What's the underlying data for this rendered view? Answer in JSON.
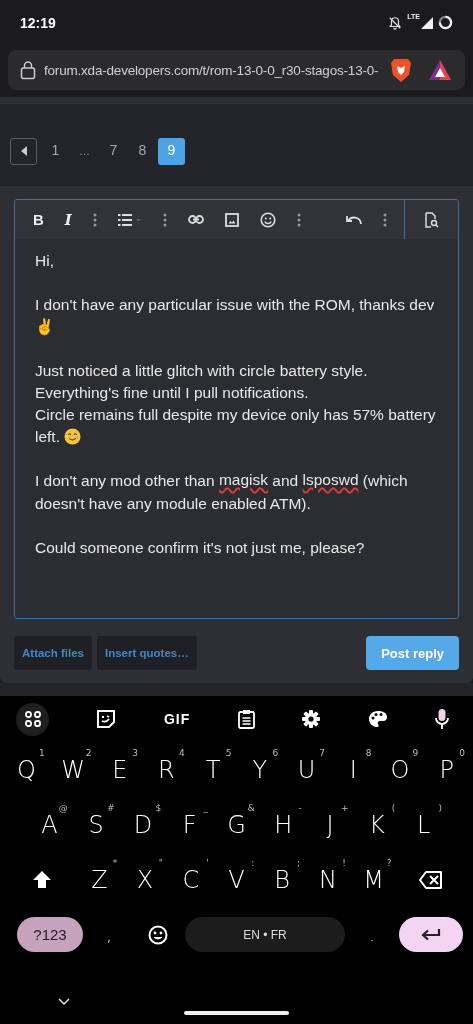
{
  "status_bar": {
    "time": "12:19",
    "network": "LTE"
  },
  "browser": {
    "url": "forum.xda-developers.com/t/rom-13-0-0_r30-stagos-13-0-"
  },
  "pagination": [
    {
      "kind": "page",
      "label": "1",
      "selected": false
    },
    {
      "kind": "gap",
      "label": "…"
    },
    {
      "kind": "page",
      "label": "7",
      "selected": false
    },
    {
      "kind": "page",
      "label": "8",
      "selected": false
    },
    {
      "kind": "page",
      "label": "9",
      "selected": true
    }
  ],
  "editor": {
    "toolbar": {
      "bold": "B",
      "italic": "I"
    },
    "paragraphs": [
      [
        [
          {
            "kind": "text",
            "text": "Hi,"
          }
        ]
      ],
      [
        [
          {
            "kind": "text",
            "text": "I don't have any particular issue with the ROM, thanks dev ✌"
          }
        ]
      ],
      [
        [
          {
            "kind": "text",
            "text": "Just noticed a little glitch with circle battery style."
          }
        ],
        [
          {
            "kind": "text",
            "text": "Everything's fine until I pull notifications."
          }
        ],
        [
          {
            "kind": "text",
            "text": "Circle remains full despite my device only has 57% battery left. "
          },
          {
            "kind": "emoji"
          }
        ]
      ],
      [
        [
          {
            "kind": "text",
            "text": "I don't any mod other than "
          },
          {
            "kind": "text",
            "text": "magisk",
            "misspelled": true
          },
          {
            "kind": "text",
            "text": " and "
          },
          {
            "kind": "text",
            "text": "lsposwd",
            "misspelled": true
          },
          {
            "kind": "text",
            "text": " (which doesn't have any module enabled ATM)."
          }
        ]
      ],
      [
        [
          {
            "kind": "text",
            "text": "Could someone confirm it's not just me, please?"
          }
        ]
      ]
    ]
  },
  "actions": {
    "attach": "Attach files",
    "quotes": "Insert quotes…",
    "post": "Post reply"
  },
  "keyboard": {
    "gif": "GIF",
    "rows": [
      [
        {
          "label": "Q",
          "hint": "1"
        },
        {
          "label": "W",
          "hint": "2"
        },
        {
          "label": "E",
          "hint": "3"
        },
        {
          "label": "R",
          "hint": "4"
        },
        {
          "label": "T",
          "hint": "5"
        },
        {
          "label": "Y",
          "hint": "6"
        },
        {
          "label": "U",
          "hint": "7"
        },
        {
          "label": "I",
          "hint": "8"
        },
        {
          "label": "O",
          "hint": "9"
        },
        {
          "label": "P",
          "hint": "0"
        }
      ],
      [
        {
          "label": "A",
          "hint": "@"
        },
        {
          "label": "S",
          "hint": "#"
        },
        {
          "label": "D",
          "hint": "$"
        },
        {
          "label": "F",
          "hint": "_"
        },
        {
          "label": "G",
          "hint": "&"
        },
        {
          "label": "H",
          "hint": "-"
        },
        {
          "label": "J",
          "hint": "+"
        },
        {
          "label": "K",
          "hint": "("
        },
        {
          "label": "L",
          "hint": ")"
        }
      ],
      [
        {
          "label": "Z",
          "hint": "*"
        },
        {
          "label": "X",
          "hint": "\""
        },
        {
          "label": "C",
          "hint": "'"
        },
        {
          "label": "V",
          "hint": ":"
        },
        {
          "label": "B",
          "hint": ";"
        },
        {
          "label": "N",
          "hint": "!"
        },
        {
          "label": "M",
          "hint": "?"
        }
      ]
    ],
    "symbols": "?123",
    "comma": ",",
    "space": "EN • FR",
    "period": "."
  }
}
